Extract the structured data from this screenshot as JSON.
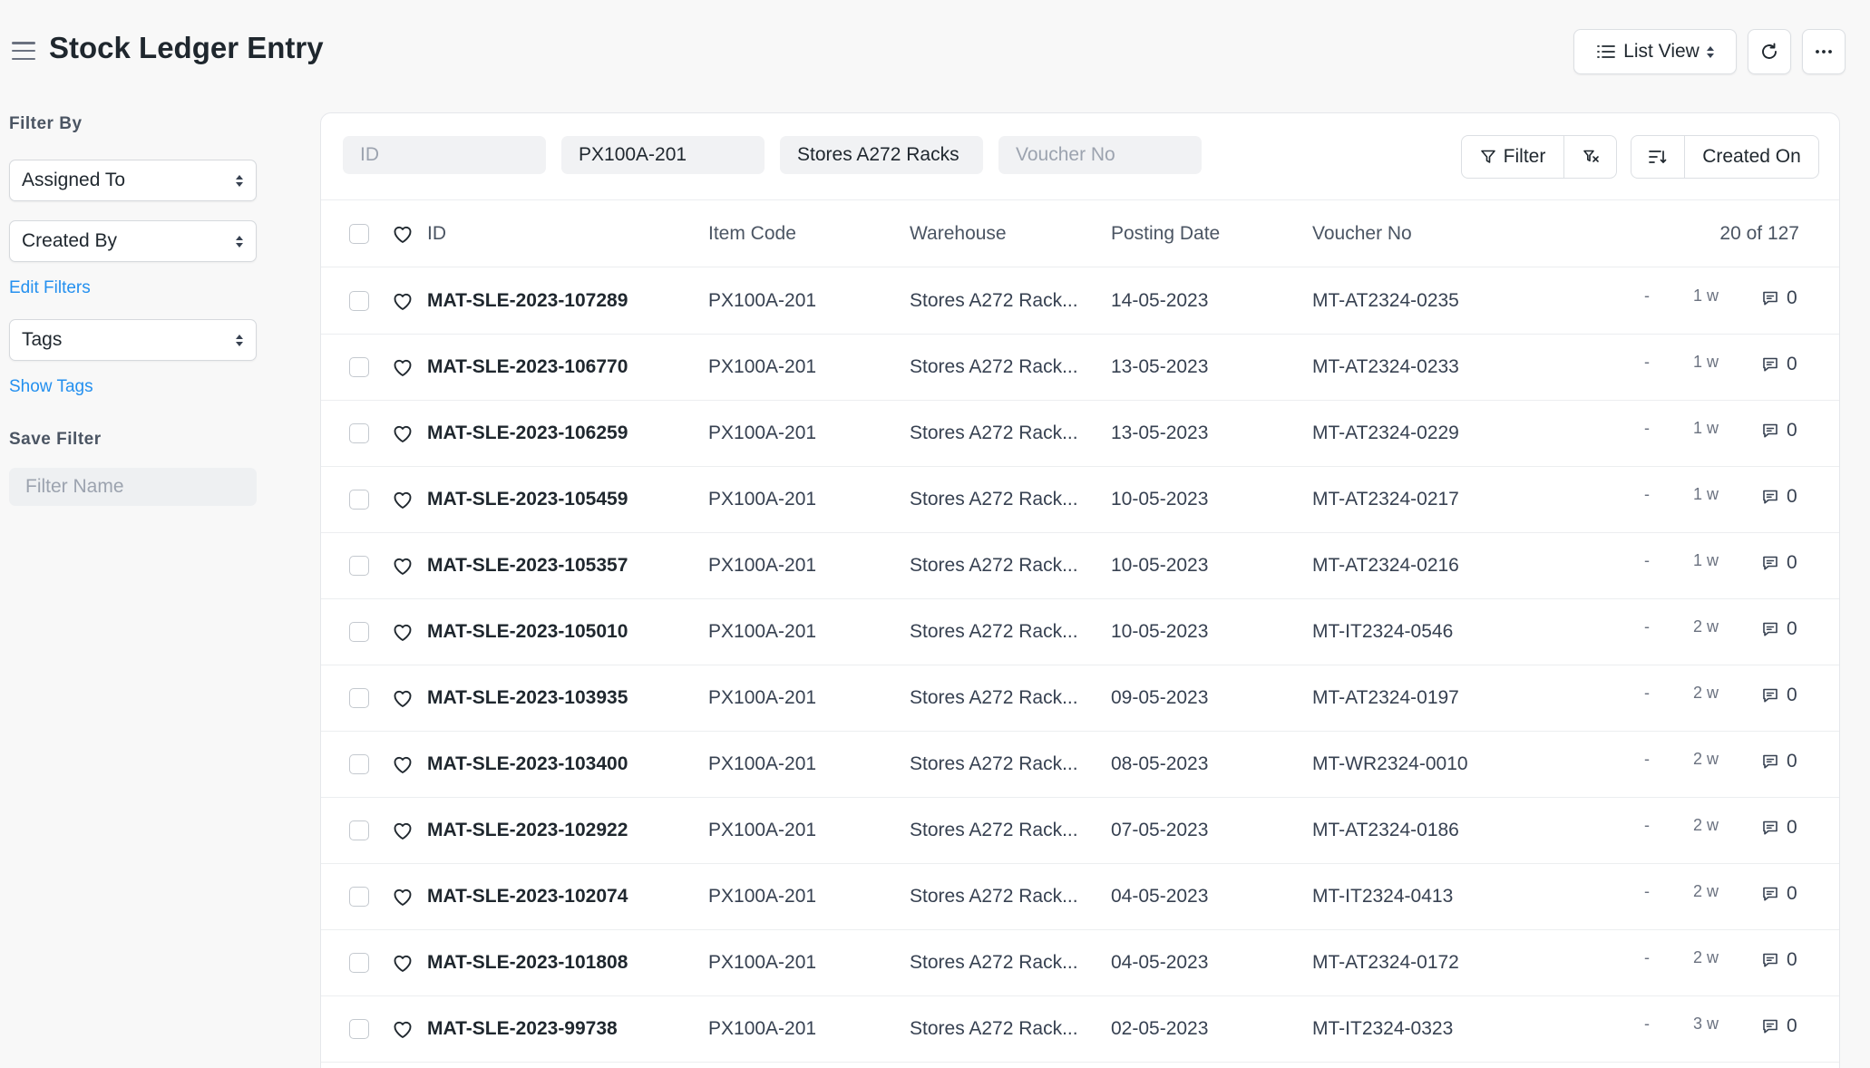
{
  "page": {
    "title": "Stock Ledger Entry",
    "list_view_label": "List View"
  },
  "sidebar": {
    "filter_by_heading": "Filter By",
    "assigned_to": "Assigned To",
    "created_by": "Created By",
    "edit_filters": "Edit Filters",
    "tags": "Tags",
    "show_tags": "Show Tags",
    "save_filter_heading": "Save Filter",
    "filter_name_placeholder": "Filter Name"
  },
  "filters": {
    "id_placeholder": "ID",
    "item_code_value": "PX100A-201",
    "warehouse_value": "Stores A272 Racks",
    "voucher_no_placeholder": "Voucher No",
    "filter_label": "Filter",
    "sort_label": "Created On"
  },
  "table": {
    "headers": {
      "id": "ID",
      "item_code": "Item Code",
      "warehouse": "Warehouse",
      "posting_date": "Posting Date",
      "voucher_no": "Voucher No",
      "count": "20 of 127"
    },
    "rows": [
      {
        "id": "MAT-SLE-2023-107289",
        "item_code": "PX100A-201",
        "warehouse": "Stores A272 Rack...",
        "posting_date": "14-05-2023",
        "voucher_no": "MT-AT2324-0235",
        "dash": "-",
        "modified": "1 w",
        "comments": "0"
      },
      {
        "id": "MAT-SLE-2023-106770",
        "item_code": "PX100A-201",
        "warehouse": "Stores A272 Rack...",
        "posting_date": "13-05-2023",
        "voucher_no": "MT-AT2324-0233",
        "dash": "-",
        "modified": "1 w",
        "comments": "0"
      },
      {
        "id": "MAT-SLE-2023-106259",
        "item_code": "PX100A-201",
        "warehouse": "Stores A272 Rack...",
        "posting_date": "13-05-2023",
        "voucher_no": "MT-AT2324-0229",
        "dash": "-",
        "modified": "1 w",
        "comments": "0"
      },
      {
        "id": "MAT-SLE-2023-105459",
        "item_code": "PX100A-201",
        "warehouse": "Stores A272 Rack...",
        "posting_date": "10-05-2023",
        "voucher_no": "MT-AT2324-0217",
        "dash": "-",
        "modified": "1 w",
        "comments": "0"
      },
      {
        "id": "MAT-SLE-2023-105357",
        "item_code": "PX100A-201",
        "warehouse": "Stores A272 Rack...",
        "posting_date": "10-05-2023",
        "voucher_no": "MT-AT2324-0216",
        "dash": "-",
        "modified": "1 w",
        "comments": "0"
      },
      {
        "id": "MAT-SLE-2023-105010",
        "item_code": "PX100A-201",
        "warehouse": "Stores A272 Rack...",
        "posting_date": "10-05-2023",
        "voucher_no": "MT-IT2324-0546",
        "dash": "-",
        "modified": "2 w",
        "comments": "0"
      },
      {
        "id": "MAT-SLE-2023-103935",
        "item_code": "PX100A-201",
        "warehouse": "Stores A272 Rack...",
        "posting_date": "09-05-2023",
        "voucher_no": "MT-AT2324-0197",
        "dash": "-",
        "modified": "2 w",
        "comments": "0"
      },
      {
        "id": "MAT-SLE-2023-103400",
        "item_code": "PX100A-201",
        "warehouse": "Stores A272 Rack...",
        "posting_date": "08-05-2023",
        "voucher_no": "MT-WR2324-0010",
        "dash": "-",
        "modified": "2 w",
        "comments": "0"
      },
      {
        "id": "MAT-SLE-2023-102922",
        "item_code": "PX100A-201",
        "warehouse": "Stores A272 Rack...",
        "posting_date": "07-05-2023",
        "voucher_no": "MT-AT2324-0186",
        "dash": "-",
        "modified": "2 w",
        "comments": "0"
      },
      {
        "id": "MAT-SLE-2023-102074",
        "item_code": "PX100A-201",
        "warehouse": "Stores A272 Rack...",
        "posting_date": "04-05-2023",
        "voucher_no": "MT-IT2324-0413",
        "dash": "-",
        "modified": "2 w",
        "comments": "0"
      },
      {
        "id": "MAT-SLE-2023-101808",
        "item_code": "PX100A-201",
        "warehouse": "Stores A272 Rack...",
        "posting_date": "04-05-2023",
        "voucher_no": "MT-AT2324-0172",
        "dash": "-",
        "modified": "2 w",
        "comments": "0"
      },
      {
        "id": "MAT-SLE-2023-99738",
        "item_code": "PX100A-201",
        "warehouse": "Stores A272 Rack...",
        "posting_date": "02-05-2023",
        "voucher_no": "MT-IT2324-0323",
        "dash": "-",
        "modified": "3 w",
        "comments": "0"
      }
    ]
  }
}
